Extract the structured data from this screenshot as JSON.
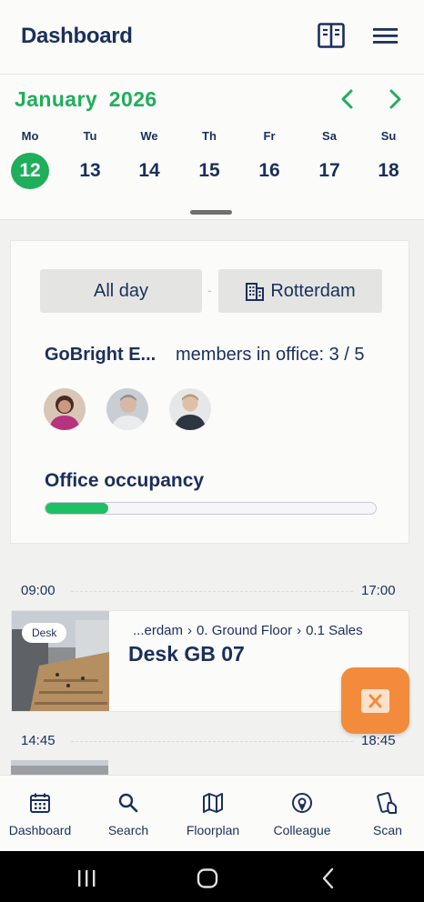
{
  "header": {
    "title": "Dashboard"
  },
  "calendar": {
    "month": "January 2026",
    "days": [
      {
        "dow": "Mo",
        "date": "12"
      },
      {
        "dow": "Tu",
        "date": "13"
      },
      {
        "dow": "We",
        "date": "14"
      },
      {
        "dow": "Th",
        "date": "15"
      },
      {
        "dow": "Fr",
        "date": "16"
      },
      {
        "dow": "Sa",
        "date": "17"
      },
      {
        "dow": "Su",
        "date": "18"
      }
    ],
    "selected_date": "12"
  },
  "office": {
    "time_filter": "All day",
    "separator": "-",
    "location": "Rotterdam",
    "org_name": "GoBright E...",
    "members_text": "members in office: 3 / 5",
    "occupancy_title": "Office occupancy",
    "occupancy_fraction": 0.19
  },
  "bookings": [
    {
      "start": "09:00",
      "end": "17:00",
      "tag": "Desk",
      "path": [
        "...erdam",
        "0. Ground Floor",
        "0.1 Sales"
      ],
      "path_separator": "›",
      "name": "Desk GB 07"
    },
    {
      "start": "14:45",
      "end": "18:45"
    }
  ],
  "bottom_nav": {
    "items": [
      {
        "label": "Dashboard",
        "icon": "calendar-icon"
      },
      {
        "label": "Search",
        "icon": "search-icon"
      },
      {
        "label": "Floorplan",
        "icon": "map-icon"
      },
      {
        "label": "Colleague",
        "icon": "location-pin-icon"
      },
      {
        "label": "Scan",
        "icon": "scan-phone-icon"
      }
    ]
  },
  "colors": {
    "brand_navy": "#1b2f5b",
    "accent_green": "#1fae5b",
    "fab_orange": "#f28c3c"
  }
}
